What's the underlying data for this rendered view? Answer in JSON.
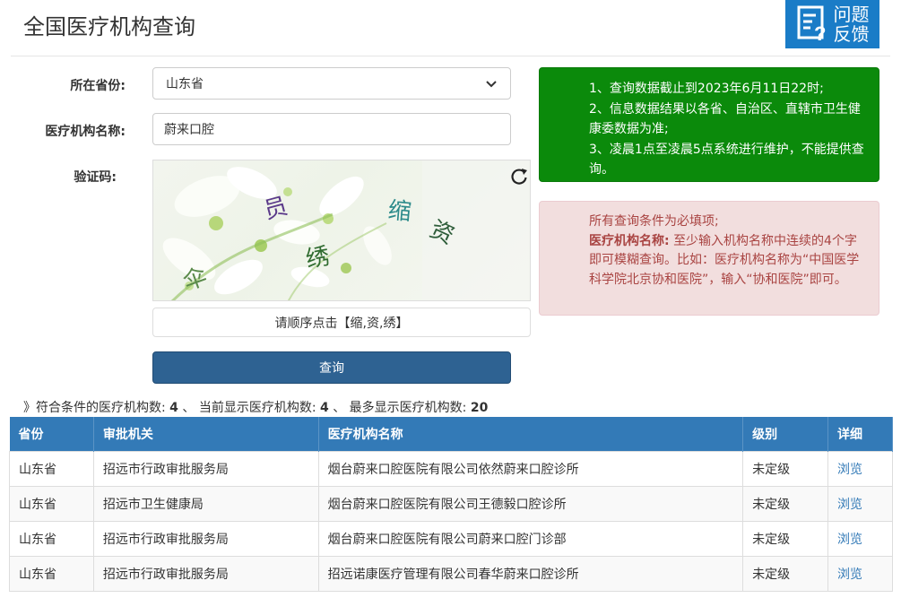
{
  "header": {
    "title": "全国医疗机构查询",
    "feedback_label_line1": "问题",
    "feedback_label_line2": "反馈"
  },
  "form": {
    "province_label": "所在省份:",
    "province_value": "山东省",
    "name_label": "医疗机构名称:",
    "name_value": "蔚来口腔",
    "captcha_label": "验证码:",
    "captcha_chars": [
      "员",
      "缩",
      "资",
      "绣",
      "伞"
    ],
    "captcha_hint": "请顺序点击【缩,资,绣】",
    "search_label": "查询"
  },
  "notices": {
    "green_lines": [
      "1、查询数据截止到2023年6月11日22时;",
      "2、信息数据结果以各省、自治区、直辖市卫生健康委数据为准;",
      "3、凌晨1点至凌晨5点系统进行维护，不能提供查询。"
    ],
    "red_intro": "所有查询条件为必填项;",
    "red_bold": "医疗机构名称:",
    "red_text": "至少输入机构名称中连续的4个字即可模糊查询。比如：医疗机构名称为“中国医学科学院北京协和医院”，输入“协和医院”即可。"
  },
  "summary": {
    "prefix": "》符合条件的医疗机构数:",
    "match_count": "4",
    "sep1": "、 当前显示医疗机构数:",
    "shown_count": "4",
    "sep2": "、 最多显示医疗机构数:",
    "max_count": "20"
  },
  "table": {
    "headers": [
      "省份",
      "审批机关",
      "医疗机构名称",
      "级别",
      "详细"
    ],
    "rows": [
      [
        "山东省",
        "招远市行政审批服务局",
        "烟台蔚来口腔医院有限公司依然蔚来口腔诊所",
        "未定级",
        "浏览"
      ],
      [
        "山东省",
        "招远市卫生健康局",
        "烟台蔚来口腔医院有限公司王德毅口腔诊所",
        "未定级",
        "浏览"
      ],
      [
        "山东省",
        "招远市行政审批服务局",
        "烟台蔚来口腔医院有限公司蔚来口腔门诊部",
        "未定级",
        "浏览"
      ],
      [
        "山东省",
        "招远市行政审批服务局",
        "招远诺康医疗管理有限公司春华蔚来口腔诊所",
        "未定级",
        "浏览"
      ]
    ]
  },
  "colors": {
    "feedback_bg": "#1a7cc7",
    "green_notice": "#0b8a0b",
    "red_notice_bg": "#f2dede",
    "red_notice_text": "#a94442",
    "button": "#2e6292",
    "table_header": "#337ab7"
  },
  "icons": {
    "feedback": "feedback-form-icon",
    "select": "chevron-down-icon",
    "refresh": "refresh-icon"
  }
}
